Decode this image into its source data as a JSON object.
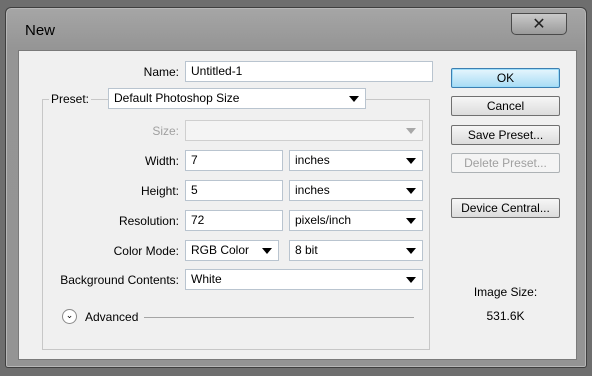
{
  "window": {
    "title": "New",
    "close_label": "✕"
  },
  "name": {
    "label": "Name:",
    "value": "Untitled-1"
  },
  "preset": {
    "label": "Preset:",
    "value": "Default Photoshop Size"
  },
  "size": {
    "label": "Size:",
    "value": ""
  },
  "width": {
    "label": "Width:",
    "value": "7",
    "unit": "inches"
  },
  "height": {
    "label": "Height:",
    "value": "5",
    "unit": "inches"
  },
  "resolution": {
    "label": "Resolution:",
    "value": "72",
    "unit": "pixels/inch"
  },
  "color_mode": {
    "label": "Color Mode:",
    "value": "RGB Color",
    "depth": "8 bit"
  },
  "background": {
    "label": "Background Contents:",
    "value": "White"
  },
  "advanced": {
    "label": "Advanced"
  },
  "buttons": {
    "ok": "OK",
    "cancel": "Cancel",
    "save_preset": "Save Preset...",
    "delete_preset": "Delete Preset...",
    "device_central": "Device Central..."
  },
  "image_size": {
    "label": "Image Size:",
    "value": "531.6K"
  }
}
